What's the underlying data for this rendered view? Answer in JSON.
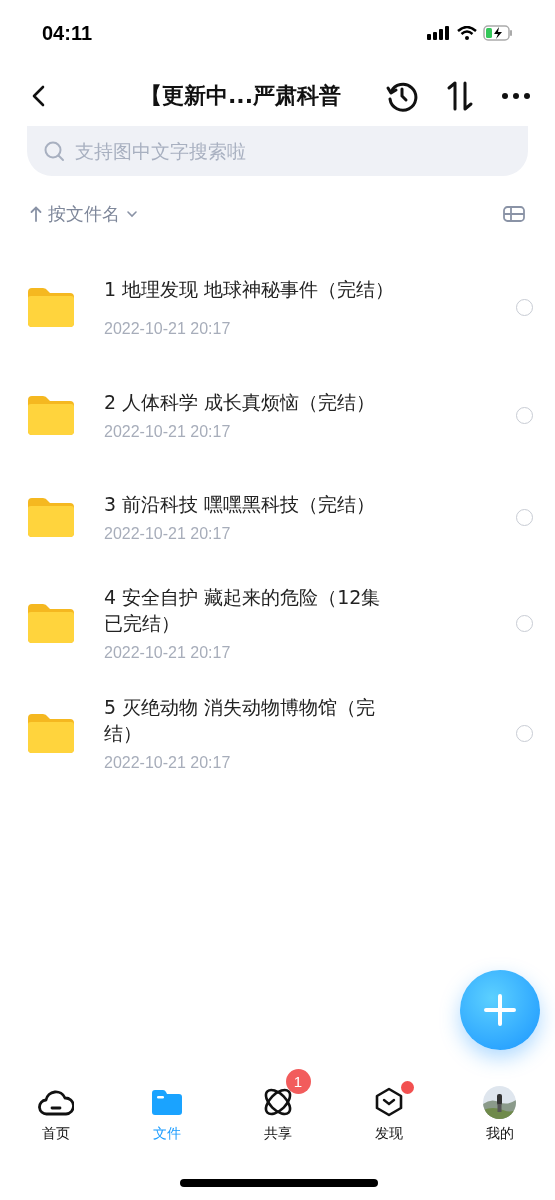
{
  "status_bar": {
    "time": "04:11"
  },
  "header": {
    "title": "【更新中...严肃科普"
  },
  "search": {
    "placeholder": "支持图中文字搜索啦"
  },
  "sort": {
    "label": "按文件名"
  },
  "folders": [
    {
      "name": "1 地理发现 地球神秘事件（完结）",
      "date": "2022-10-21 20:17",
      "selected": false
    },
    {
      "name": "2 人体科学 成长真烦恼（完结）",
      "date": "2022-10-21 20:17",
      "selected": false
    },
    {
      "name": "3 前沿科技 嘿嘿黑科技（完结）",
      "date": "2022-10-21 20:17",
      "selected": false
    },
    {
      "name": "4 安全自护 藏起来的危险（12集已完结）",
      "date": "2022-10-21 20:17",
      "selected": false
    },
    {
      "name": "5 灭绝动物 消失动物博物馆（完结）",
      "date": "2022-10-21 20:17",
      "selected": false
    }
  ],
  "tab_bar": [
    {
      "label": "首页",
      "kind": "cloud",
      "selected": false
    },
    {
      "label": "文件",
      "kind": "folder",
      "selected": true
    },
    {
      "label": "共享",
      "kind": "orbit",
      "selected": false,
      "badge": "1"
    },
    {
      "label": "发现",
      "kind": "hexagon",
      "selected": false,
      "dot": true
    },
    {
      "label": "我的",
      "kind": "avatar",
      "selected": false
    }
  ]
}
